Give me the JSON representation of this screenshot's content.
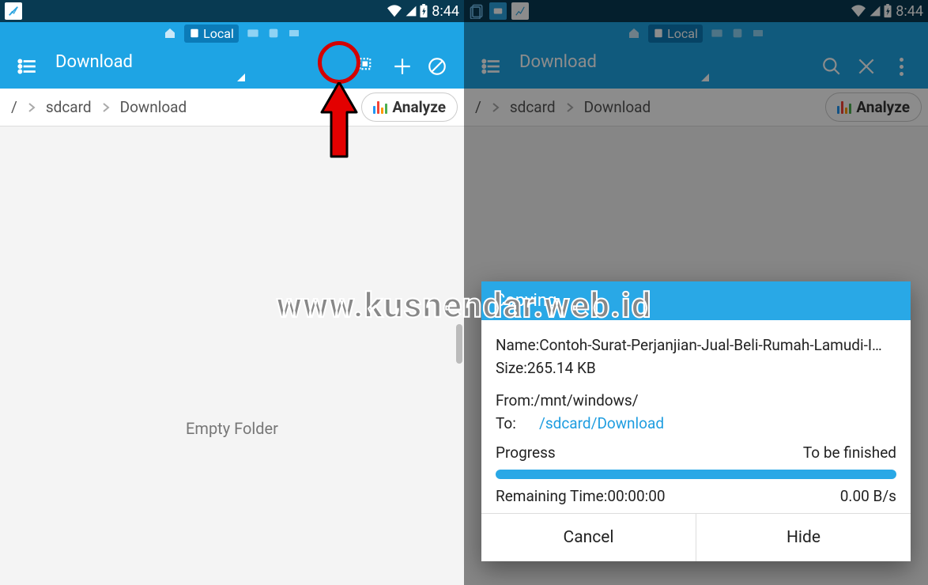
{
  "watermark": "www.kusnendar.web.id",
  "left": {
    "status_time": "8:44",
    "tabstrip_label": "Local",
    "title": "Download",
    "breadcrumb": [
      "/",
      "sdcard",
      "Download"
    ],
    "analyze_label": "Analyze",
    "empty_text": "Empty Folder"
  },
  "right": {
    "status_time": "8:44",
    "tabstrip_label": "Local",
    "title": "Download",
    "breadcrumb": [
      "/",
      "sdcard",
      "Download"
    ],
    "analyze_label": "Analyze",
    "dialog": {
      "header": "Copying",
      "name_label": "Name: ",
      "name_value": "Contoh-Surat-Perjanjian-Jual-Beli-Rumah-Lamudi-I…",
      "size_label": "Size: ",
      "size_value": "265.14 KB",
      "from_label": "From:",
      "from_value": "/mnt/windows/",
      "to_label": "To:",
      "to_value": "/sdcard/Download",
      "progress_label": "Progress",
      "progress_status": "To be finished",
      "remaining_label": "Remaining Time:",
      "remaining_value": "00:00:00",
      "speed": "0.00 B/s",
      "cancel": "Cancel",
      "hide": "Hide"
    }
  }
}
